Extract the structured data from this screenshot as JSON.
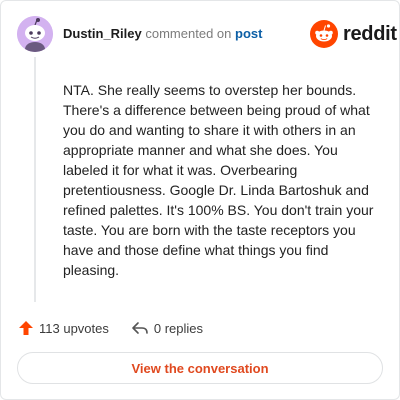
{
  "comment": {
    "author": "Dustin_Riley",
    "commented_on_text": "commented on",
    "post_link_text": "post",
    "body": "NTA. She really seems to overstep her bounds. There's a difference between being proud of what you do and wanting to share it with others in an appropriate manner and what she does. You labeled it for what it was. Overbearing pretentiousness. Google Dr. Linda Bartoshuk and refined palettes. It's 100% BS. You don't train your taste. You are born with the taste receptors you have and those define what things you find pleasing."
  },
  "brand": {
    "name": "reddit",
    "accent": "#ff4500"
  },
  "actions": {
    "upvotes": "113 upvotes",
    "replies": "0 replies"
  },
  "footer": {
    "view_button": "View the conversation"
  },
  "colors": {
    "avatar_bg": "#d3b2f0",
    "link": "#0c5fa6",
    "cta_text": "#e0491f"
  },
  "icons": {
    "upvote": "upvote-arrow-icon",
    "reply": "reply-arrow-icon",
    "logo": "reddit-snoo-icon"
  }
}
